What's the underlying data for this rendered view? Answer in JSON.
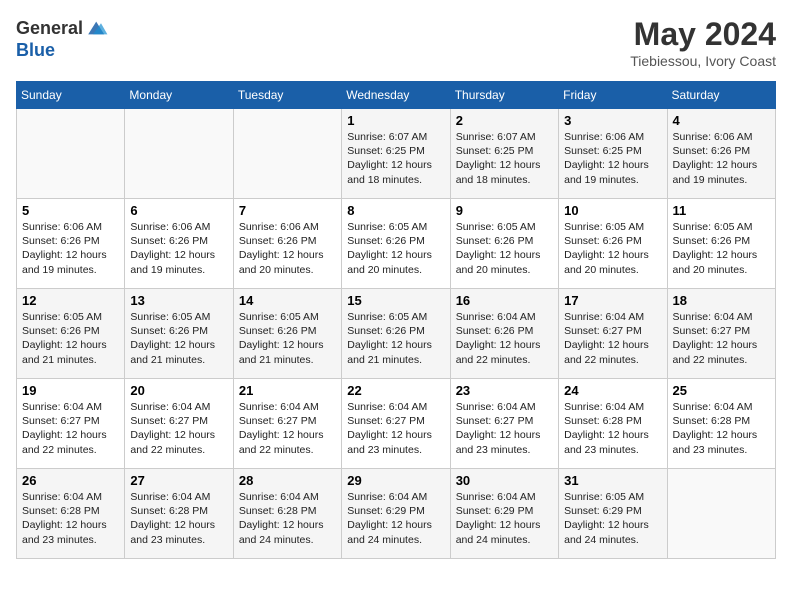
{
  "header": {
    "logo_line1": "General",
    "logo_line2": "Blue",
    "month_year": "May 2024",
    "location": "Tiebiessou, Ivory Coast"
  },
  "weekdays": [
    "Sunday",
    "Monday",
    "Tuesday",
    "Wednesday",
    "Thursday",
    "Friday",
    "Saturday"
  ],
  "weeks": [
    [
      {
        "day": "",
        "text": ""
      },
      {
        "day": "",
        "text": ""
      },
      {
        "day": "",
        "text": ""
      },
      {
        "day": "1",
        "text": "Sunrise: 6:07 AM\nSunset: 6:25 PM\nDaylight: 12 hours and 18 minutes."
      },
      {
        "day": "2",
        "text": "Sunrise: 6:07 AM\nSunset: 6:25 PM\nDaylight: 12 hours and 18 minutes."
      },
      {
        "day": "3",
        "text": "Sunrise: 6:06 AM\nSunset: 6:25 PM\nDaylight: 12 hours and 19 minutes."
      },
      {
        "day": "4",
        "text": "Sunrise: 6:06 AM\nSunset: 6:26 PM\nDaylight: 12 hours and 19 minutes."
      }
    ],
    [
      {
        "day": "5",
        "text": "Sunrise: 6:06 AM\nSunset: 6:26 PM\nDaylight: 12 hours and 19 minutes."
      },
      {
        "day": "6",
        "text": "Sunrise: 6:06 AM\nSunset: 6:26 PM\nDaylight: 12 hours and 19 minutes."
      },
      {
        "day": "7",
        "text": "Sunrise: 6:06 AM\nSunset: 6:26 PM\nDaylight: 12 hours and 20 minutes."
      },
      {
        "day": "8",
        "text": "Sunrise: 6:05 AM\nSunset: 6:26 PM\nDaylight: 12 hours and 20 minutes."
      },
      {
        "day": "9",
        "text": "Sunrise: 6:05 AM\nSunset: 6:26 PM\nDaylight: 12 hours and 20 minutes."
      },
      {
        "day": "10",
        "text": "Sunrise: 6:05 AM\nSunset: 6:26 PM\nDaylight: 12 hours and 20 minutes."
      },
      {
        "day": "11",
        "text": "Sunrise: 6:05 AM\nSunset: 6:26 PM\nDaylight: 12 hours and 20 minutes."
      }
    ],
    [
      {
        "day": "12",
        "text": "Sunrise: 6:05 AM\nSunset: 6:26 PM\nDaylight: 12 hours and 21 minutes."
      },
      {
        "day": "13",
        "text": "Sunrise: 6:05 AM\nSunset: 6:26 PM\nDaylight: 12 hours and 21 minutes."
      },
      {
        "day": "14",
        "text": "Sunrise: 6:05 AM\nSunset: 6:26 PM\nDaylight: 12 hours and 21 minutes."
      },
      {
        "day": "15",
        "text": "Sunrise: 6:05 AM\nSunset: 6:26 PM\nDaylight: 12 hours and 21 minutes."
      },
      {
        "day": "16",
        "text": "Sunrise: 6:04 AM\nSunset: 6:26 PM\nDaylight: 12 hours and 22 minutes."
      },
      {
        "day": "17",
        "text": "Sunrise: 6:04 AM\nSunset: 6:27 PM\nDaylight: 12 hours and 22 minutes."
      },
      {
        "day": "18",
        "text": "Sunrise: 6:04 AM\nSunset: 6:27 PM\nDaylight: 12 hours and 22 minutes."
      }
    ],
    [
      {
        "day": "19",
        "text": "Sunrise: 6:04 AM\nSunset: 6:27 PM\nDaylight: 12 hours and 22 minutes."
      },
      {
        "day": "20",
        "text": "Sunrise: 6:04 AM\nSunset: 6:27 PM\nDaylight: 12 hours and 22 minutes."
      },
      {
        "day": "21",
        "text": "Sunrise: 6:04 AM\nSunset: 6:27 PM\nDaylight: 12 hours and 22 minutes."
      },
      {
        "day": "22",
        "text": "Sunrise: 6:04 AM\nSunset: 6:27 PM\nDaylight: 12 hours and 23 minutes."
      },
      {
        "day": "23",
        "text": "Sunrise: 6:04 AM\nSunset: 6:27 PM\nDaylight: 12 hours and 23 minutes."
      },
      {
        "day": "24",
        "text": "Sunrise: 6:04 AM\nSunset: 6:28 PM\nDaylight: 12 hours and 23 minutes."
      },
      {
        "day": "25",
        "text": "Sunrise: 6:04 AM\nSunset: 6:28 PM\nDaylight: 12 hours and 23 minutes."
      }
    ],
    [
      {
        "day": "26",
        "text": "Sunrise: 6:04 AM\nSunset: 6:28 PM\nDaylight: 12 hours and 23 minutes."
      },
      {
        "day": "27",
        "text": "Sunrise: 6:04 AM\nSunset: 6:28 PM\nDaylight: 12 hours and 23 minutes."
      },
      {
        "day": "28",
        "text": "Sunrise: 6:04 AM\nSunset: 6:28 PM\nDaylight: 12 hours and 24 minutes."
      },
      {
        "day": "29",
        "text": "Sunrise: 6:04 AM\nSunset: 6:29 PM\nDaylight: 12 hours and 24 minutes."
      },
      {
        "day": "30",
        "text": "Sunrise: 6:04 AM\nSunset: 6:29 PM\nDaylight: 12 hours and 24 minutes."
      },
      {
        "day": "31",
        "text": "Sunrise: 6:05 AM\nSunset: 6:29 PM\nDaylight: 12 hours and 24 minutes."
      },
      {
        "day": "",
        "text": ""
      }
    ]
  ]
}
